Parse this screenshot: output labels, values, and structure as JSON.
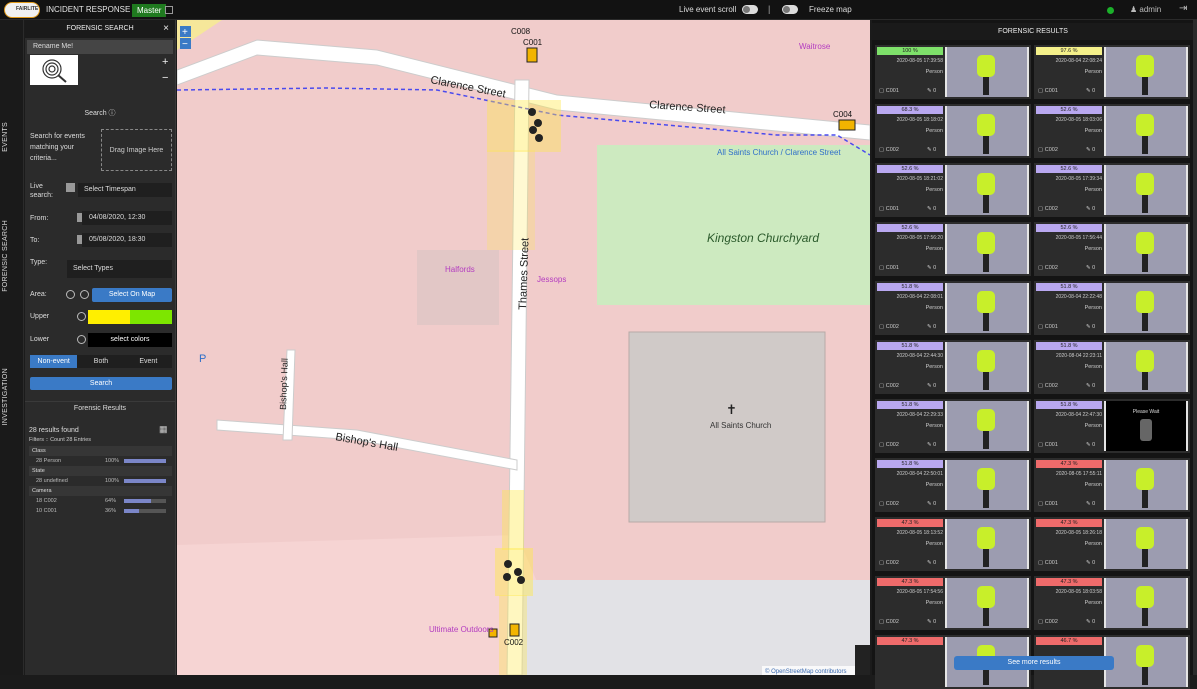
{
  "app": {
    "logo_text": "FAIRLITE",
    "title": "INCIDENT RESPONSE",
    "branch": "Master",
    "live_scroll_label": "Live event scroll",
    "separator": "|",
    "freeze_label": "Freeze map",
    "user": "admin",
    "status_color": "#1bb02a"
  },
  "nav": {
    "tabs": [
      "EVENTS",
      "FORENSIC SEARCH",
      "INVESTIGATION"
    ]
  },
  "panel": {
    "title": "FORENSIC SEARCH",
    "close": "×",
    "rename": "Rename Me!",
    "plus": "+",
    "minus": "−",
    "search_section": "Search ⓘ",
    "search_desc": "Search for events matching your criteria...",
    "drag_label": "Drag Image Here",
    "live_search_label": "Live search:",
    "timespan_value": "Select Timespan",
    "from_label": "From:",
    "from_value": "04/08/2020, 12:30",
    "to_label": "To:",
    "to_value": "05/08/2020, 18:30",
    "type_label": "Type:",
    "type_value": "Select Types",
    "area_label": "Area:",
    "area_button": "Select On Map",
    "upper_label": "Upper",
    "upper_colors": [
      "#ffef00",
      "#7de600"
    ],
    "lower_label": "Lower",
    "lower_value": "select colors",
    "segments": [
      "Non-event",
      "Both",
      "Event"
    ],
    "segment_active": "Non-event",
    "search_button": "Search",
    "results_header": "Forensic Results",
    "results_found": "28 results found",
    "filters": "Filters :: Count 28 Entries",
    "stats": [
      {
        "group": "Class",
        "rows": [
          {
            "label": "28 Person",
            "pct": "100%",
            "frac": 1.0
          }
        ]
      },
      {
        "group": "State",
        "rows": [
          {
            "label": "28 undefined",
            "pct": "100%",
            "frac": 1.0
          }
        ]
      },
      {
        "group": "Camera",
        "rows": [
          {
            "label": "18 C002",
            "pct": "64%",
            "frac": 0.64
          },
          {
            "label": "10 C001",
            "pct": "36%",
            "frac": 0.36
          }
        ]
      }
    ]
  },
  "map": {
    "streets": [
      "Clarence Street",
      "Clarence Street",
      "Thames Street",
      "Bishop's Hall",
      "Bishop's Hall"
    ],
    "places": [
      "Waitrose",
      "All Saints Church / Clarence Street",
      "Kingston Churchyard",
      "Halfords",
      "Jessops",
      "All Saints Church",
      "Ultimate Outdoors"
    ],
    "cameras": [
      "C008",
      "C001",
      "C004",
      "C002"
    ],
    "zoom_in": "+",
    "zoom_out": "−",
    "parking": "P",
    "attribution": "© OpenStreetMap contributors"
  },
  "results": {
    "title": "FORENSIC RESULTS",
    "more_button": "See more results",
    "cards": [
      {
        "score": "100 %",
        "color": "#7ee06a",
        "time": "2020-08-05 17:39:58",
        "cls": "Person",
        "cam": "C001",
        "count": "0"
      },
      {
        "score": "97.6 %",
        "color": "#f4f08a",
        "time": "2020-08-04 22:08:24",
        "cls": "Person",
        "cam": "C001",
        "count": "0"
      },
      {
        "score": "68.3 %",
        "color": "#b9a8f0",
        "time": "2020-08-05 18:18:02",
        "cls": "Person",
        "cam": "C002",
        "count": "0"
      },
      {
        "score": "52.6 %",
        "color": "#b9a8f0",
        "time": "2020-08-05 18:03:06",
        "cls": "Person",
        "cam": "C002",
        "count": "0"
      },
      {
        "score": "52.6 %",
        "color": "#b9a8f0",
        "time": "2020-08-05 18:21:02",
        "cls": "Person",
        "cam": "C001",
        "count": "0"
      },
      {
        "score": "52.6 %",
        "color": "#b9a8f0",
        "time": "2020-08-05 17:39:34",
        "cls": "Person",
        "cam": "C002",
        "count": "0"
      },
      {
        "score": "52.6 %",
        "color": "#b9a8f0",
        "time": "2020-08-05 17:56:20",
        "cls": "Person",
        "cam": "C001",
        "count": "0"
      },
      {
        "score": "52.6 %",
        "color": "#b9a8f0",
        "time": "2020-08-05 17:56:44",
        "cls": "Person",
        "cam": "C002",
        "count": "0"
      },
      {
        "score": "51.8 %",
        "color": "#b9a8f0",
        "time": "2020-08-04 22:08:01",
        "cls": "Person",
        "cam": "C002",
        "count": "0"
      },
      {
        "score": "51.8 %",
        "color": "#b9a8f0",
        "time": "2020-08-04 22:22:48",
        "cls": "Person",
        "cam": "C001",
        "count": "0"
      },
      {
        "score": "51.8 %",
        "color": "#b9a8f0",
        "time": "2020-08-04 22:44:30",
        "cls": "Person",
        "cam": "C002",
        "count": "0"
      },
      {
        "score": "51.8 %",
        "color": "#b9a8f0",
        "time": "2020-08-04 22:23:11",
        "cls": "Person",
        "cam": "C002",
        "count": "0"
      },
      {
        "score": "51.8 %",
        "color": "#b9a8f0",
        "time": "2020-08-04 22:29:33",
        "cls": "Person",
        "cam": "C002",
        "count": "0"
      },
      {
        "score": "51.8 %",
        "color": "#b9a8f0",
        "time": "2020-08-04 22:47:30",
        "cls": "Person",
        "cam": "C001",
        "count": "0",
        "wait": "Please Wait"
      },
      {
        "score": "51.8 %",
        "color": "#b9a8f0",
        "time": "2020-08-04 22:50:01",
        "cls": "Person",
        "cam": "C002",
        "count": "0"
      },
      {
        "score": "47.3 %",
        "color": "#ef6b6b",
        "time": "2020-08-05 17:55:11",
        "cls": "Person",
        "cam": "C001",
        "count": "0"
      },
      {
        "score": "47.3 %",
        "color": "#ef6b6b",
        "time": "2020-08-05 18:13:52",
        "cls": "Person",
        "cam": "C002",
        "count": "0"
      },
      {
        "score": "47.3 %",
        "color": "#ef6b6b",
        "time": "2020-08-05 18:26:18",
        "cls": "Person",
        "cam": "C001",
        "count": "0"
      },
      {
        "score": "47.3 %",
        "color": "#ef6b6b",
        "time": "2020-08-05 17:54:56",
        "cls": "Person",
        "cam": "C002",
        "count": "0"
      },
      {
        "score": "47.3 %",
        "color": "#ef6b6b",
        "time": "2020-08-05 18:03:58",
        "cls": "Person",
        "cam": "C002",
        "count": "0"
      },
      {
        "score": "47.3 %",
        "color": "#ef6b6b",
        "time": "",
        "cls": "",
        "cam": "",
        "count": ""
      },
      {
        "score": "46.7 %",
        "color": "#ef6b6b",
        "time": "",
        "cls": "",
        "cam": "",
        "count": ""
      }
    ]
  }
}
